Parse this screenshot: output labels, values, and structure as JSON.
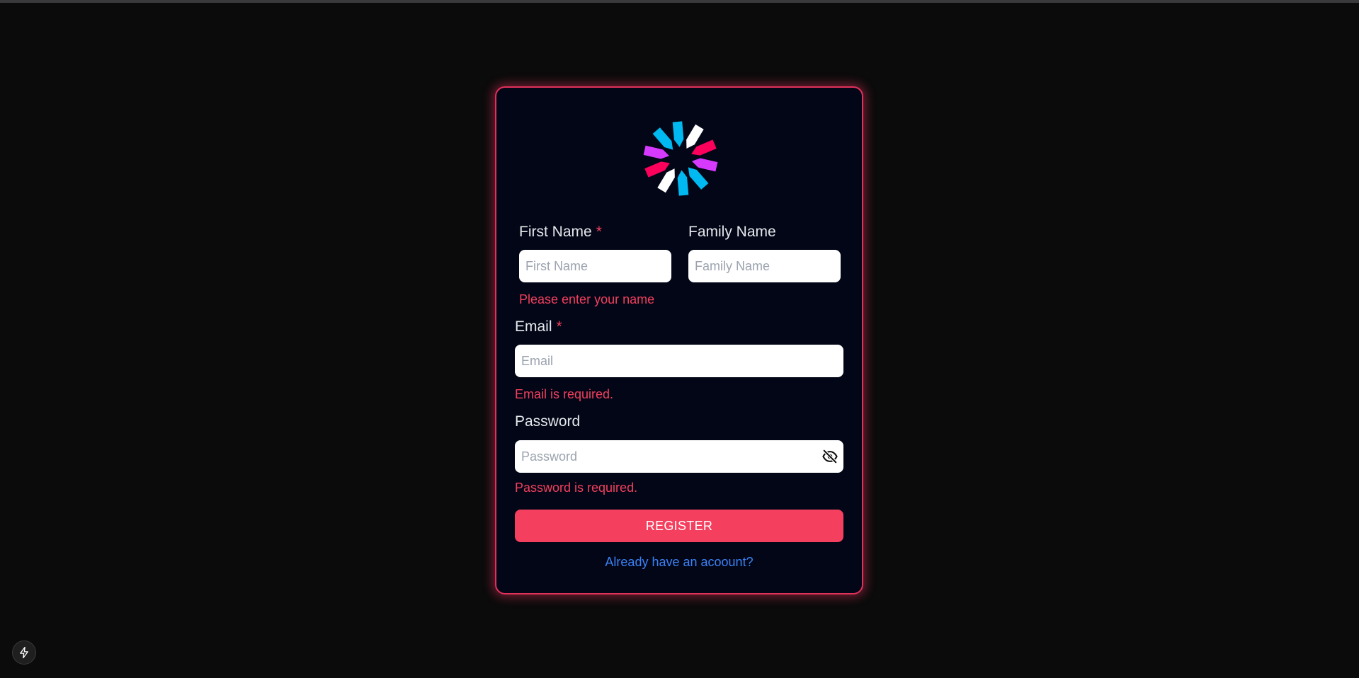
{
  "form": {
    "first_name": {
      "label": "First Name",
      "required_mark": "*",
      "placeholder": "First Name",
      "value": "",
      "error": "Please enter your name"
    },
    "family_name": {
      "label": "Family Name",
      "placeholder": "Family Name",
      "value": ""
    },
    "email": {
      "label": "Email",
      "required_mark": "*",
      "placeholder": "Email",
      "value": "",
      "error": "Email is required."
    },
    "password": {
      "label": "Password",
      "placeholder": "Password",
      "value": "",
      "error": "Password is required."
    },
    "register_label": "REGISTER",
    "login_link": "Already have an acoount?"
  },
  "icons": {
    "logo": "jwt-logo-icon",
    "password_toggle": "eye-off-icon",
    "dev_badge": "lightning-bolt-icon"
  },
  "colors": {
    "background": "#0b0b0b",
    "card": "#020617",
    "card_border": "#e1305a",
    "accent": "#f43f5e",
    "error": "#f43f5e",
    "link": "#3b82f6",
    "logo_pink": "#fb015b",
    "logo_purple": "#d63aff",
    "logo_cyan": "#00b9f1",
    "logo_white": "#ffffff"
  }
}
